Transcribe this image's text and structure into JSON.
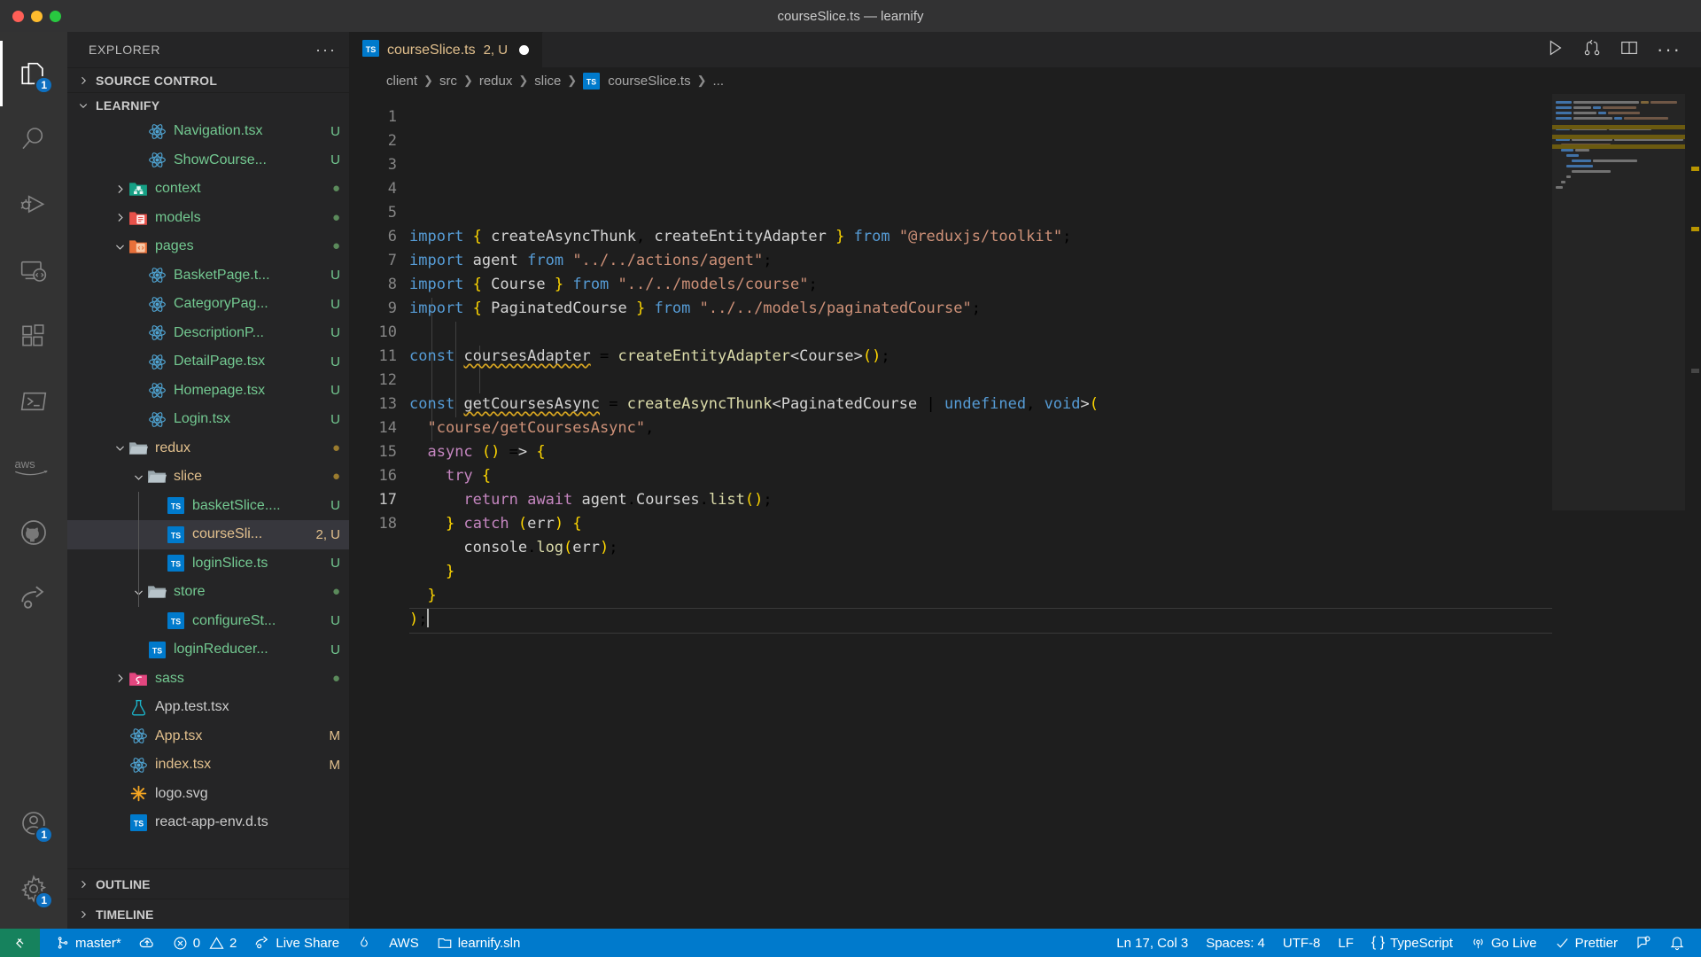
{
  "window": {
    "title": "courseSlice.ts — learnify",
    "traffic_lights": [
      "close-red",
      "minimize-yellow",
      "maximize-green"
    ]
  },
  "activity_bar": {
    "items": [
      {
        "name": "explorer",
        "icon": "files-icon",
        "badge": "1",
        "active": true
      },
      {
        "name": "search",
        "icon": "search-icon",
        "badge": "",
        "active": false
      },
      {
        "name": "run-and-debug",
        "icon": "debug-icon",
        "badge": "",
        "active": false
      },
      {
        "name": "remote-explorer",
        "icon": "remote-icon",
        "badge": "",
        "active": false
      },
      {
        "name": "extensions",
        "icon": "extensions-icon",
        "badge": "",
        "active": false
      },
      {
        "name": "terminal-powershell",
        "icon": "powershell-icon",
        "badge": "",
        "active": false
      },
      {
        "name": "aws-toolkit",
        "icon": "aws-icon",
        "label": "aws",
        "badge": "",
        "active": false
      },
      {
        "name": "github",
        "icon": "github-icon",
        "badge": "",
        "active": false
      },
      {
        "name": "live-share",
        "icon": "live-share-icon",
        "badge": "",
        "active": false
      }
    ],
    "bottom_items": [
      {
        "name": "accounts",
        "icon": "account-icon",
        "badge": "1"
      },
      {
        "name": "settings",
        "icon": "gear-icon",
        "badge": "1"
      }
    ]
  },
  "sidebar": {
    "header_title": "EXPLORER",
    "more_actions": "···",
    "sections": [
      {
        "label": "SOURCE CONTROL",
        "expanded": false
      },
      {
        "label": "LEARNIFY",
        "expanded": true
      }
    ],
    "footer_sections": [
      {
        "label": "OUTLINE",
        "expanded": false
      },
      {
        "label": "TIMELINE",
        "expanded": false
      }
    ],
    "tree": [
      {
        "label": "Navigation.tsx",
        "icon": "react-icon",
        "indent": 3,
        "twisty": "",
        "deco": "U",
        "deco_type": "u",
        "color": "green",
        "selected": false
      },
      {
        "label": "ShowCourse...",
        "icon": "react-icon",
        "indent": 3,
        "twisty": "",
        "deco": "U",
        "deco_type": "u",
        "color": "green",
        "selected": false
      },
      {
        "label": "context",
        "icon": "folder-context-icon",
        "indent": 2,
        "twisty": "collapsed",
        "deco": "●",
        "deco_type": "dot",
        "color": "green",
        "selected": false
      },
      {
        "label": "models",
        "icon": "folder-models-icon",
        "indent": 2,
        "twisty": "collapsed",
        "deco": "●",
        "deco_type": "dot",
        "color": "green",
        "selected": false
      },
      {
        "label": "pages",
        "icon": "folder-pages-icon",
        "indent": 2,
        "twisty": "expanded",
        "deco": "●",
        "deco_type": "dot",
        "color": "green",
        "selected": false
      },
      {
        "label": "BasketPage.t...",
        "icon": "react-icon",
        "indent": 3,
        "twisty": "",
        "deco": "U",
        "deco_type": "u",
        "color": "green",
        "selected": false
      },
      {
        "label": "CategoryPag...",
        "icon": "react-icon",
        "indent": 3,
        "twisty": "",
        "deco": "U",
        "deco_type": "u",
        "color": "green",
        "selected": false
      },
      {
        "label": "DescriptionP...",
        "icon": "react-icon",
        "indent": 3,
        "twisty": "",
        "deco": "U",
        "deco_type": "u",
        "color": "green",
        "selected": false
      },
      {
        "label": "DetailPage.tsx",
        "icon": "react-icon",
        "indent": 3,
        "twisty": "",
        "deco": "U",
        "deco_type": "u",
        "color": "green",
        "selected": false
      },
      {
        "label": "Homepage.tsx",
        "icon": "react-icon",
        "indent": 3,
        "twisty": "",
        "deco": "U",
        "deco_type": "u",
        "color": "green",
        "selected": false
      },
      {
        "label": "Login.tsx",
        "icon": "react-icon",
        "indent": 3,
        "twisty": "",
        "deco": "U",
        "deco_type": "u",
        "color": "green",
        "selected": false
      },
      {
        "label": "redux",
        "icon": "folder-open-icon",
        "indent": 2,
        "twisty": "expanded",
        "deco": "●",
        "deco_type": "dot-gold",
        "color": "gold",
        "selected": false
      },
      {
        "label": "slice",
        "icon": "folder-open-icon",
        "indent": 3,
        "twisty": "expanded",
        "deco": "●",
        "deco_type": "dot-gold",
        "color": "gold",
        "selected": false
      },
      {
        "label": "basketSlice....",
        "icon": "ts-icon",
        "indent": 4,
        "twisty": "",
        "deco": "U",
        "deco_type": "u",
        "color": "green",
        "selected": false
      },
      {
        "label": "courseSli...",
        "icon": "ts-icon",
        "indent": 4,
        "twisty": "",
        "deco": "2, U",
        "deco_type": "m",
        "color": "gold",
        "selected": true
      },
      {
        "label": "loginSlice.ts",
        "icon": "ts-icon",
        "indent": 4,
        "twisty": "",
        "deco": "U",
        "deco_type": "u",
        "color": "green",
        "selected": false
      },
      {
        "label": "store",
        "icon": "folder-open-icon",
        "indent": 3,
        "twisty": "expanded",
        "deco": "●",
        "deco_type": "dot",
        "color": "green",
        "selected": false
      },
      {
        "label": "configureSt...",
        "icon": "ts-icon",
        "indent": 4,
        "twisty": "",
        "deco": "U",
        "deco_type": "u",
        "color": "green",
        "selected": false
      },
      {
        "label": "loginReducer...",
        "icon": "ts-icon",
        "indent": 3,
        "twisty": "",
        "deco": "U",
        "deco_type": "u",
        "color": "green",
        "selected": false
      },
      {
        "label": "sass",
        "icon": "folder-sass-icon",
        "indent": 2,
        "twisty": "collapsed",
        "deco": "●",
        "deco_type": "dot",
        "color": "green",
        "selected": false
      },
      {
        "label": "App.test.tsx",
        "icon": "test-icon",
        "indent": 2,
        "twisty": "",
        "deco": "",
        "deco_type": "",
        "color": "white",
        "selected": false
      },
      {
        "label": "App.tsx",
        "icon": "react-icon",
        "indent": 2,
        "twisty": "",
        "deco": "M",
        "deco_type": "m",
        "color": "gold",
        "selected": false
      },
      {
        "label": "index.tsx",
        "icon": "react-icon",
        "indent": 2,
        "twisty": "",
        "deco": "M",
        "deco_type": "m",
        "color": "gold",
        "selected": false
      },
      {
        "label": "logo.svg",
        "icon": "svg-icon",
        "indent": 2,
        "twisty": "",
        "deco": "",
        "deco_type": "",
        "color": "white",
        "selected": false
      },
      {
        "label": "react-app-env.d.ts",
        "icon": "ts-icon",
        "indent": 2,
        "twisty": "",
        "deco": "",
        "deco_type": "",
        "color": "white",
        "selected": false
      }
    ]
  },
  "editor": {
    "tab": {
      "filename": "courseSlice.ts",
      "deco": "2, U",
      "icon": "ts-icon",
      "dirty": true
    },
    "tab_actions": [
      {
        "name": "run-button",
        "icon": "play-icon"
      },
      {
        "name": "source-control-graph-button",
        "icon": "git-compare-icon"
      },
      {
        "name": "split-editor-button",
        "icon": "split-editor-icon"
      },
      {
        "name": "more-actions-button",
        "icon": "ellipsis-icon"
      }
    ],
    "breadcrumb": [
      "client",
      "src",
      "redux",
      "slice",
      "courseSlice.ts",
      "..."
    ],
    "breadcrumb_file_icon": "ts-icon",
    "line_numbers": [
      1,
      2,
      3,
      4,
      5,
      6,
      7,
      8,
      9,
      10,
      11,
      12,
      13,
      14,
      15,
      16,
      17,
      18
    ],
    "active_line": 17,
    "code_text": [
      "import { createAsyncThunk, createEntityAdapter } from \"@reduxjs/toolkit\";",
      "import agent from \"../../actions/agent\";",
      "import { Course } from \"../../models/course\";",
      "import { PaginatedCourse } from \"../../models/paginatedCourse\";",
      "",
      "const coursesAdapter = createEntityAdapter<Course>();",
      "",
      "const getCoursesAsync = createAsyncThunk<PaginatedCourse | undefined, void>(",
      "  \"course/getCoursesAsync\",",
      "  async () => {",
      "    try {",
      "      return await agent.Courses.list();",
      "    } catch (err) {",
      "      console.log(err);",
      "    }",
      "  }",
      ");",
      ""
    ]
  },
  "status_bar": {
    "left": [
      {
        "name": "remote-host",
        "icon": "remote-icon",
        "label": ""
      },
      {
        "name": "branch",
        "icon": "git-branch-icon",
        "label": "master*"
      },
      {
        "name": "sync-changes",
        "icon": "cloud-upload-icon",
        "label": ""
      },
      {
        "name": "problems",
        "icon": "error-warning-icon",
        "label": "0",
        "label2": "2"
      },
      {
        "name": "live-share",
        "icon": "live-share-icon",
        "label": "Live Share"
      },
      {
        "name": "flame",
        "icon": "flame-icon",
        "label": ""
      },
      {
        "name": "aws",
        "icon": "",
        "label": "AWS"
      },
      {
        "name": "solution",
        "icon": "folder-icon",
        "label": "learnify.sln"
      }
    ],
    "right": [
      {
        "name": "cursor-position",
        "icon": "",
        "label": "Ln 17, Col 3"
      },
      {
        "name": "indentation",
        "icon": "",
        "label": "Spaces: 4"
      },
      {
        "name": "encoding",
        "icon": "",
        "label": "UTF-8"
      },
      {
        "name": "eol",
        "icon": "",
        "label": "LF"
      },
      {
        "name": "language-mode",
        "icon": "braces-icon",
        "label": "TypeScript"
      },
      {
        "name": "go-live",
        "icon": "broadcast-icon",
        "label": "Go Live"
      },
      {
        "name": "prettier",
        "icon": "check-icon",
        "label": "Prettier"
      },
      {
        "name": "screencast",
        "icon": "screencast-icon",
        "label": ""
      },
      {
        "name": "notifications",
        "icon": "bell-icon",
        "label": ""
      }
    ]
  },
  "colors": {
    "accent": "#007acc",
    "remote_green": "#16825d",
    "sidebar_bg": "#252526",
    "editor_bg": "#1e1e1e",
    "activitybar_bg": "#333333",
    "selection": "#37373d"
  }
}
